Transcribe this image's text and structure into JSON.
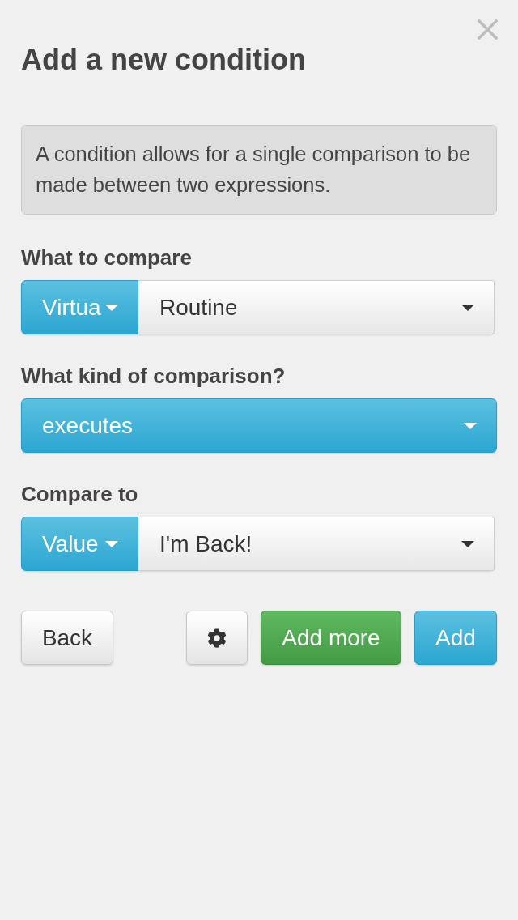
{
  "dialog": {
    "title": "Add a new condition",
    "description": "A condition allows for a single comparison to be made between two expressions."
  },
  "fields": [
    {
      "kind": "split",
      "label": "What to compare",
      "type": "Virtua",
      "value": "Routine"
    },
    {
      "kind": "full",
      "label": "What kind of comparison?",
      "value": "executes"
    },
    {
      "kind": "split",
      "label": "Compare to",
      "type": "Value",
      "value": "I'm Back!"
    }
  ],
  "buttons": [
    {
      "kind": "default",
      "label": "Back"
    },
    {
      "kind": "icon"
    },
    {
      "kind": "success",
      "label": "Add more"
    },
    {
      "kind": "primary",
      "label": "Add"
    }
  ]
}
